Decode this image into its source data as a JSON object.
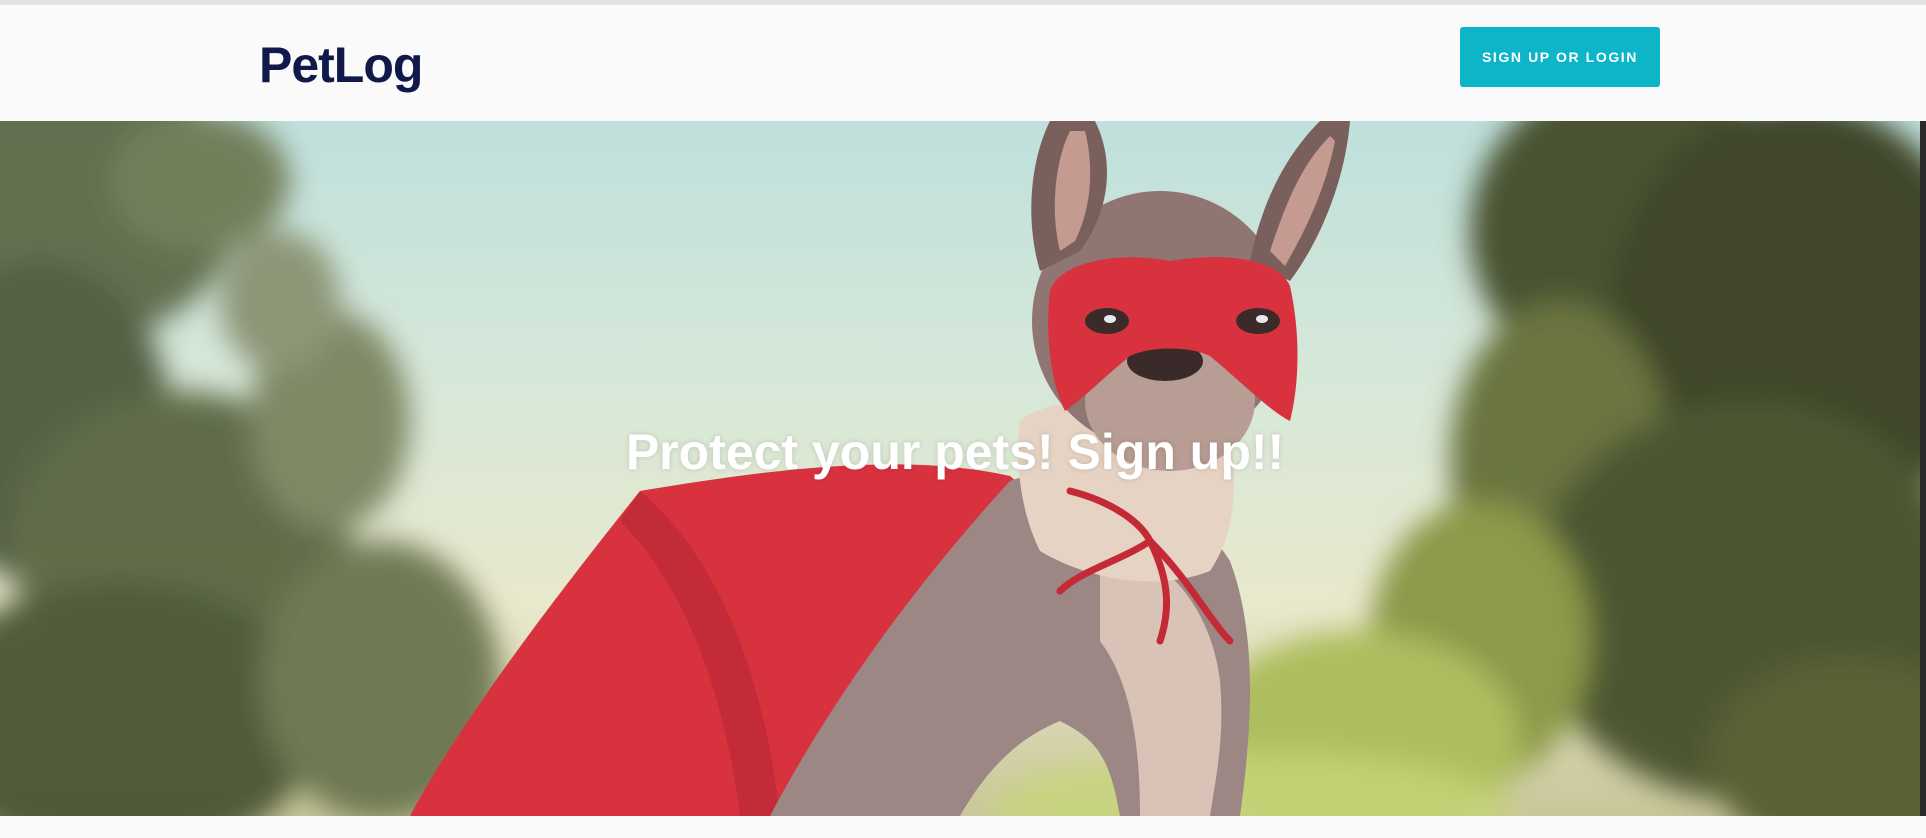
{
  "navbar": {
    "brand": "PetLog",
    "cta_label": "SIGN UP OR LOGIN"
  },
  "hero": {
    "title": "Protect your pets! Sign up!!",
    "image_alt_icon": "superhero-dog-image"
  },
  "colors": {
    "brand_text": "#10194a",
    "cta_background": "#0db5c9",
    "cape_red": "#d8323f"
  }
}
